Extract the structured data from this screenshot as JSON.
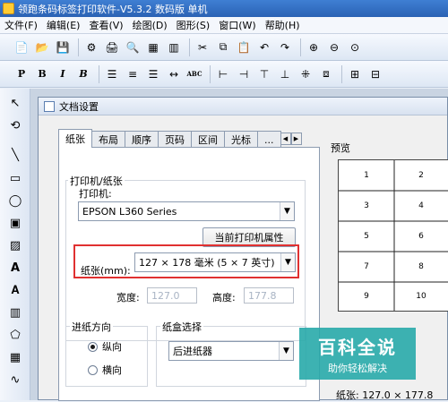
{
  "app": {
    "title": "领跑条码标签打印软件-V5.3.2 数码版 单机"
  },
  "menu": [
    "文件(F)",
    "编辑(E)",
    "查看(V)",
    "绘图(D)",
    "图形(S)",
    "窗口(W)",
    "帮助(H)"
  ],
  "toolbar1": [
    "new-icon",
    "open-icon",
    "save-icon",
    "settings-icon",
    "print-icon",
    "print-preview-icon",
    "grid-icon",
    "barcode-icon",
    "cut-icon",
    "copy-icon",
    "paste-icon",
    "undo-icon",
    "redo-icon",
    "zoom-in-icon",
    "zoom-out-icon",
    "zoom-fit-icon"
  ],
  "toolbar2": {
    "text_buttons": [
      "P",
      "B",
      "I",
      "B",
      "ABC"
    ]
  },
  "dialog": {
    "title": "文档设置",
    "tabs": [
      "纸张",
      "布局",
      "顺序",
      "页码",
      "区间",
      "光标",
      "..."
    ],
    "printer_group": "打印机/纸张",
    "printer_label": "打印机:",
    "printer_value": "EPSON L360 Series",
    "printer_props_button": "当前打印机属性",
    "paper_label": "纸张(mm):",
    "paper_value": "127 × 178 毫米 (5 × 7 英寸)",
    "width_label": "宽度:",
    "width_value": "127.0",
    "height_label": "高度:",
    "height_value": "177.8",
    "feed_group": "进纸方向",
    "feed_options": [
      "纵向",
      "横向"
    ],
    "feed_selected": "纵向",
    "tray_group": "纸盒选择",
    "tray_value": "后进纸器",
    "preview_label": "预览",
    "preview_cells": [
      "1",
      "2",
      "3",
      "4",
      "5",
      "6",
      "7",
      "8",
      "9",
      "10"
    ],
    "paper_size_text": "纸张: 127.0 × 177.8"
  },
  "watermark": {
    "line1": "百科全说",
    "line2": "助你轻松解决"
  }
}
